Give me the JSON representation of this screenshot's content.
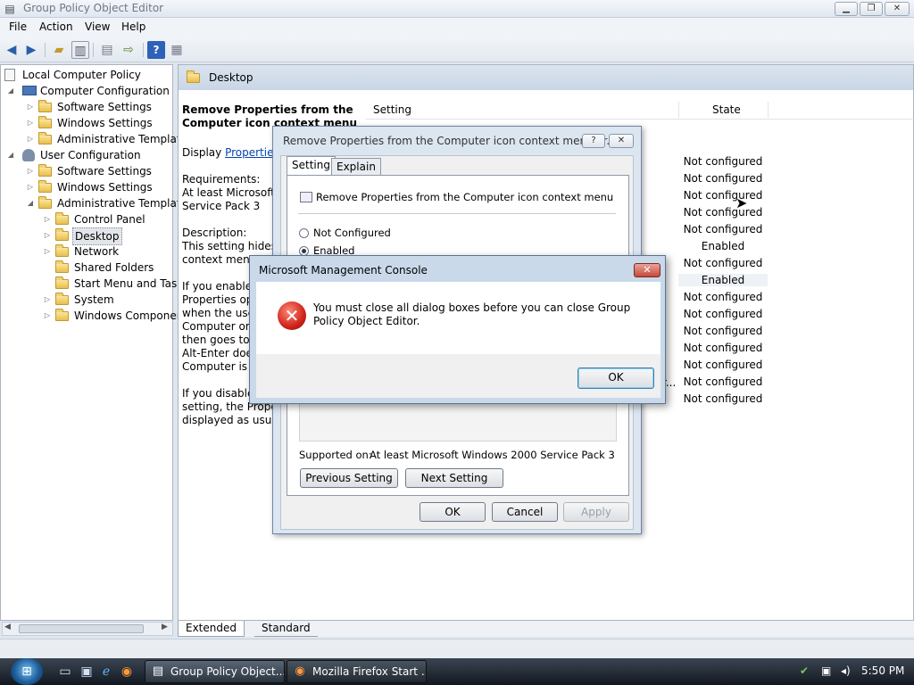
{
  "window": {
    "title": "Group Policy Object Editor"
  },
  "menu": [
    "File",
    "Action",
    "View",
    "Help"
  ],
  "tree": [
    {
      "label": "Local Computer Policy",
      "level": 0
    },
    {
      "label": "Computer Configuration",
      "level": 1
    },
    {
      "label": "Software Settings",
      "level": 2
    },
    {
      "label": "Windows Settings",
      "level": 2
    },
    {
      "label": "Administrative Template",
      "level": 2
    },
    {
      "label": "User Configuration",
      "level": 1
    },
    {
      "label": "Software Settings",
      "level": 2
    },
    {
      "label": "Windows Settings",
      "level": 2
    },
    {
      "label": "Administrative Template",
      "level": 2
    },
    {
      "label": "Control Panel",
      "level": 3
    },
    {
      "label": "Desktop",
      "level": 3
    },
    {
      "label": "Network",
      "level": 3
    },
    {
      "label": "Shared Folders",
      "level": 3
    },
    {
      "label": "Start Menu and Task",
      "level": 3
    },
    {
      "label": "System",
      "level": 3
    },
    {
      "label": "Windows Componer",
      "level": 3
    }
  ],
  "right": {
    "header": "Desktop",
    "desc_title": "Remove Properties from the Computer icon context menu",
    "display_label": "Display",
    "display_link": "Properties",
    "requirements_label": "Requirements:",
    "requirements_text": "At least Microsoft W",
    "requirements_text2": "Service Pack 3",
    "description_label": "Description:",
    "description_lines": [
      "This setting hides P",
      "context menu"
    ],
    "enable_lines": [
      "If you enable t",
      "Properties opt",
      "when the user",
      "Computer or c",
      "then goes to t",
      "Alt-Enter does",
      "Computer is s"
    ],
    "disable_lines": [
      "If you disable",
      "setting, the Propert",
      "displayed as usual."
    ],
    "col_setting": "Setting",
    "col_state": "State",
    "states": [
      "Not configured",
      "Not configured",
      "Not configured",
      "Not configured",
      "Not configured",
      "Enabled",
      "Not configured",
      "Enabled",
      "Not configured",
      "Not configured",
      "Not configured",
      "Not configured",
      "Not configured",
      "Not configured",
      "Not configured"
    ],
    "trunc_mark": "r...",
    "tab_extended": "Extended",
    "tab_standard": "Standard"
  },
  "prop_dialog": {
    "title": "Remove Properties from the Computer icon context menu Pr...",
    "help_btn": "?",
    "close_btn": "✕",
    "tab_setting": "Setting",
    "tab_explain": "Explain",
    "policy_name": "Remove Properties from the Computer icon context menu",
    "radio_not_configured": "Not Configured",
    "radio_enabled": "Enabled",
    "supported_label": "Supported on:",
    "supported_value": "At least Microsoft Windows 2000 Service Pack 3",
    "prev_btn": "Previous Setting",
    "next_btn": "Next Setting",
    "ok": "OK",
    "cancel": "Cancel",
    "apply": "Apply"
  },
  "error_dialog": {
    "title": "Microsoft Management Console",
    "message": "You must close all dialog boxes before you can close Group Policy Object Editor.",
    "ok": "OK"
  },
  "taskbar": {
    "tasks": [
      "Group Policy Object...",
      "Mozilla Firefox Start ..."
    ],
    "clock": "5:50 PM"
  }
}
